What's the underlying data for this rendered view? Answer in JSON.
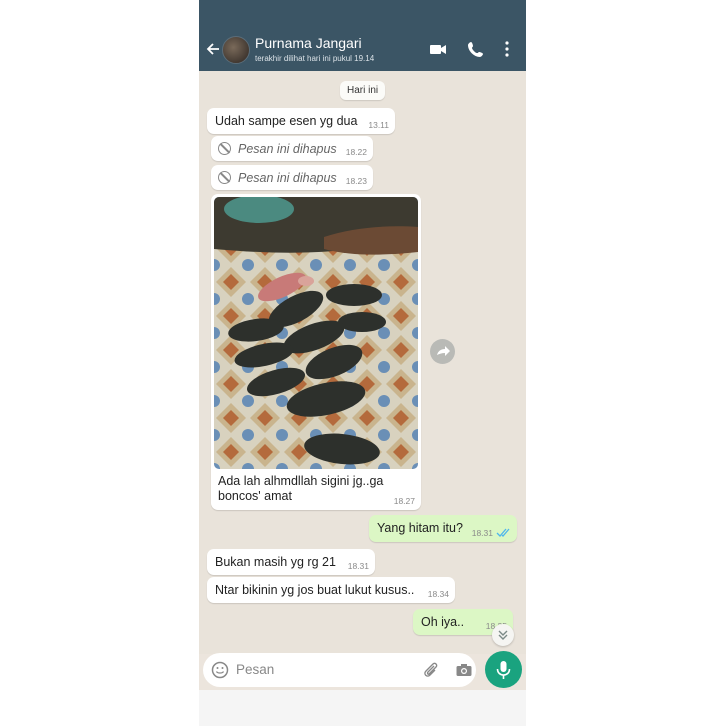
{
  "header": {
    "contact_name": "Purnama Jangari",
    "last_seen": "terakhir dilihat hari ini pukul 19.14"
  },
  "chat": {
    "day_label": "Hari ini",
    "messages": [
      {
        "text": "Udah sampe esen yg dua",
        "time": "13.11"
      },
      {
        "text": "Pesan ini dihapus",
        "time": "18.22"
      },
      {
        "text": "Pesan ini dihapus",
        "time": "18.23"
      },
      {
        "text_line1": "Ada lah alhmdllah sigini jg..ga",
        "text_line2": "boncos' amat",
        "time": "18.27"
      },
      {
        "text": "Yang hitam itu?",
        "time": "18.31"
      },
      {
        "text": "Bukan masih yg rg 21",
        "time": "18.31"
      },
      {
        "text": "Ntar bikinin yg jos buat lukut kusus..",
        "time": "18.34"
      },
      {
        "text": "Oh iya..",
        "time": "18.35"
      }
    ]
  },
  "composer": {
    "placeholder": "Pesan"
  },
  "colors": {
    "header": "#3b5565",
    "outgoing_bubble": "#dcf7c5",
    "incoming_bubble": "#ffffff",
    "mic_button": "#1aa37f",
    "read_ticks": "#4fb6ec"
  },
  "icons": [
    "back-arrow-icon",
    "video-call-icon",
    "phone-icon",
    "more-vert-icon",
    "ban-icon",
    "share-icon",
    "double-check-icon",
    "chevron-down-icon",
    "emoji-icon",
    "attach-icon",
    "camera-icon",
    "mic-icon"
  ]
}
